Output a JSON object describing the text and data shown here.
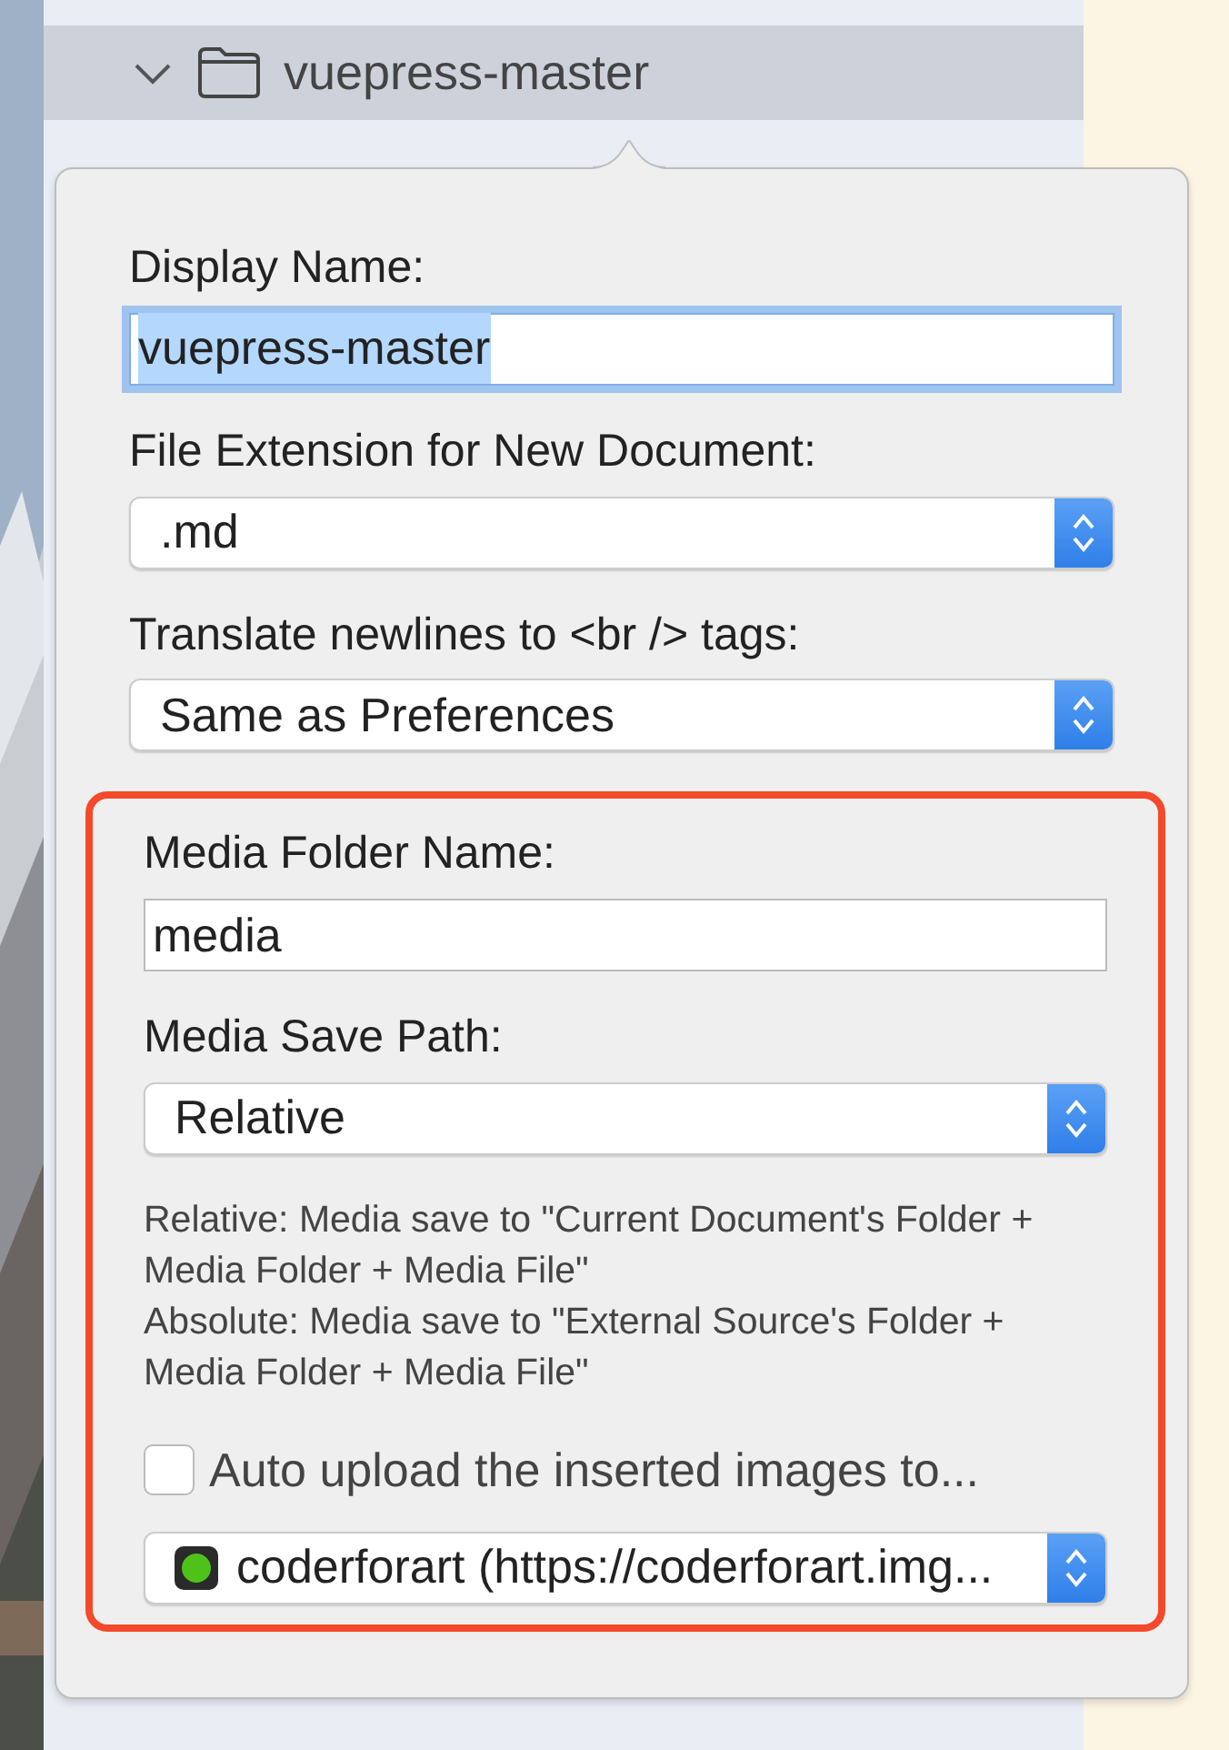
{
  "tree": {
    "items": [
      {
        "label": "vuepress-master",
        "expanded": true,
        "selected": true
      }
    ]
  },
  "popover": {
    "fields": [
      {
        "kind": "text",
        "label": "Display Name:",
        "value": "vuepress-master",
        "focused": true,
        "text_selected": true
      },
      {
        "kind": "select",
        "label": "File Extension for New Document:",
        "value": ".md"
      },
      {
        "kind": "select",
        "label": "Translate newlines to <br /> tags:",
        "value": "Same as Preferences"
      }
    ],
    "media": {
      "highlighted": true,
      "fields": [
        {
          "kind": "text",
          "label": "Media Folder Name:",
          "value": "media",
          "focused": false,
          "text_selected": false
        },
        {
          "kind": "select",
          "label": "Media Save Path:",
          "value": "Relative"
        },
        {
          "kind": "note",
          "text": "Relative: Media save to \"Current Document's Folder + Media Folder + Media File\""
        },
        {
          "kind": "note",
          "text": "Absolute: Media save to \"External Source's Folder + Media Folder + Media File\""
        },
        {
          "kind": "checkbox",
          "label": "Auto upload the inserted images to...",
          "checked": false
        },
        {
          "kind": "select",
          "value": "coderforart (https://coderforart.img...",
          "has_icon": true
        }
      ]
    }
  }
}
